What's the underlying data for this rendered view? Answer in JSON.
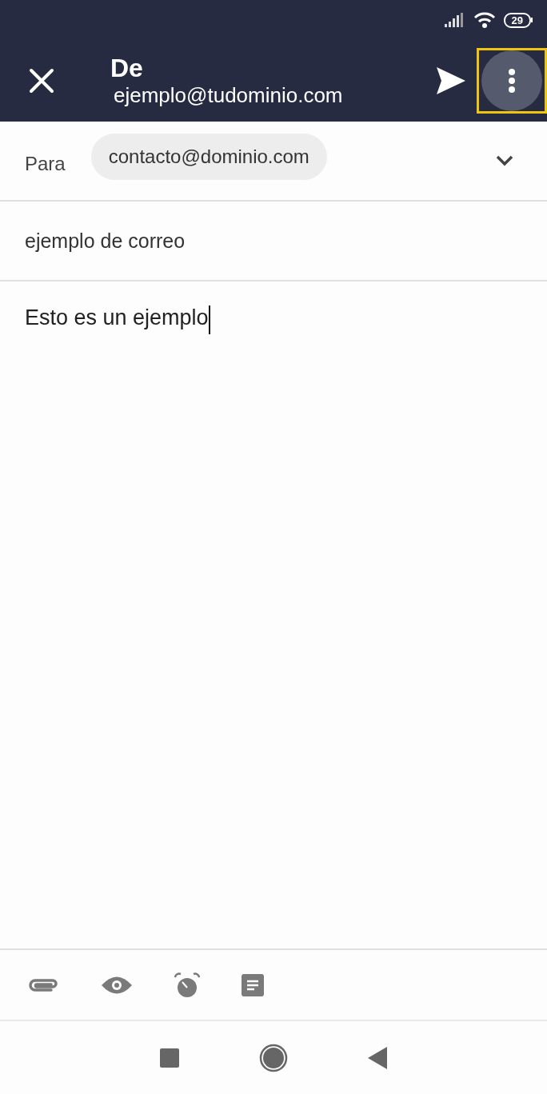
{
  "status_bar": {
    "battery": "29"
  },
  "app_bar": {
    "title": "De",
    "from": "ejemplo@tudominio.com",
    "more_button": {
      "highlighted": true
    }
  },
  "to_field": {
    "label": "Para",
    "chips": [
      "contacto@dominio.com"
    ]
  },
  "subject": {
    "value": "ejemplo de correo"
  },
  "body": {
    "value": "Esto es un ejemplo",
    "cursor": true
  }
}
